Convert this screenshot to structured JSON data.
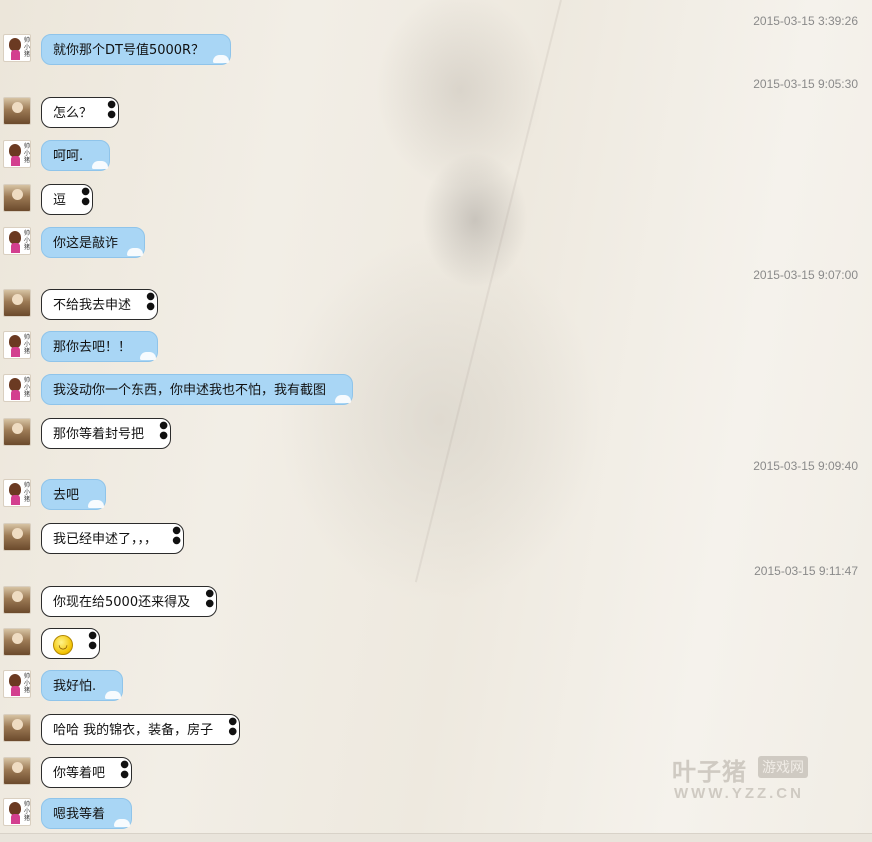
{
  "timestamps": [
    "2015-03-15 3:39:26",
    "2015-03-15 9:05:30",
    "2015-03-15 9:07:00",
    "2015-03-15 9:09:40",
    "2015-03-15 9:11:47"
  ],
  "messages": [
    {
      "sender": "me",
      "text": "就你那个DT号值5000R？"
    },
    {
      "sender": "other",
      "text": "怎么？"
    },
    {
      "sender": "me",
      "text": "呵呵."
    },
    {
      "sender": "other",
      "text": "逗"
    },
    {
      "sender": "me",
      "text": "你这是敲诈"
    },
    {
      "sender": "other",
      "text": "不给我去申述"
    },
    {
      "sender": "me",
      "text": "那你去吧！！"
    },
    {
      "sender": "me",
      "text": "我没动你一个东西，你申述我也不怕，我有截图"
    },
    {
      "sender": "other",
      "text": "那你等着封号把"
    },
    {
      "sender": "me",
      "text": "去吧"
    },
    {
      "sender": "other",
      "text": "我已经申述了，，，"
    },
    {
      "sender": "other",
      "text": "你现在给5000还来得及"
    },
    {
      "sender": "other",
      "text": "",
      "emoji": "smiley-emoji"
    },
    {
      "sender": "me",
      "text": "我好怕."
    },
    {
      "sender": "other",
      "text": "哈哈 我的锦衣，装备，房子"
    },
    {
      "sender": "other",
      "text": "你等着吧"
    },
    {
      "sender": "me",
      "text": "嗯我等着"
    }
  ],
  "watermark": {
    "brand": "叶子猪",
    "sub": "游戏网",
    "url": "WWW.YZZ.CN"
  },
  "colors": {
    "my_bubble": "#a9d6f5",
    "other_bubble": "#ffffff",
    "timestamp": "#8a8a8a"
  }
}
